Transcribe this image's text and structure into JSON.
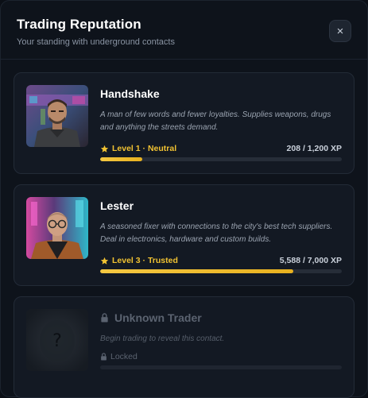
{
  "header": {
    "title": "Trading Reputation",
    "subtitle": "Your standing with underground contacts",
    "close_label": "×"
  },
  "contacts": [
    {
      "name": "Handshake",
      "description": "A man of few words and fewer loyalties. Supplies weapons, drugs and anything the streets demand.",
      "level_label": "Level 1 · Neutral",
      "xp_label": "208 / 1,200 XP",
      "progress": 0.173,
      "status": "unlocked"
    },
    {
      "name": "Lester",
      "description": "A seasoned fixer with connections to the city's best tech suppliers. Deal in electronics, hardware and custom builds.",
      "level_label": "Level 3 · Trusted",
      "xp_label": "5,588 / 7,000 XP",
      "progress": 0.798,
      "status": "unlocked"
    },
    {
      "name": "Unknown Trader",
      "description": "Begin trading to reveal this contact.",
      "level_label": "Locked",
      "avatar_glyph": "?",
      "progress": 0,
      "status": "locked"
    }
  ],
  "colors": {
    "accent": "#f1c232",
    "background": "#0e131b",
    "card": "#131923"
  },
  "icons": {
    "star": "star-icon",
    "lock": "lock-icon",
    "close": "close-icon"
  }
}
